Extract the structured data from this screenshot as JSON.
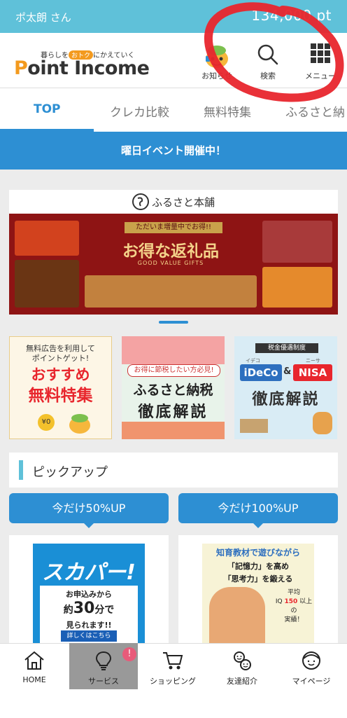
{
  "status": {
    "username": "ポ太朗 さん",
    "points": "134,000 pt"
  },
  "header": {
    "logo_tagline_pre": "暮らしを",
    "logo_tagline_pill": "おトク",
    "logo_tagline_post": "にかえていく",
    "logo_p": "P",
    "logo_rest": "oint Income",
    "news_label": "お知らせ",
    "search_label": "検索",
    "menu_label": "メニュー"
  },
  "tabs": [
    "TOP",
    "クレカ比較",
    "無料特集",
    "ふるさと納"
  ],
  "event_banner": "曜日イベント開催中！",
  "furusato": {
    "brand": "ふるさと本舗",
    "ribbon": "ただいま増量中でお得!!",
    "title": "お得な返礼品",
    "subtitle": "GOOD VALUE GIFTS"
  },
  "banners": {
    "free": {
      "line1": "無料広告を利用して",
      "line2": "ポイントゲット!",
      "line3": "おすすめ",
      "line4": "無料特集",
      "coin": "¥0"
    },
    "tax": {
      "line1": "お得に節税したい方必見!",
      "line2": "ふるさと納税",
      "line3": "徹底解説"
    },
    "ideco": {
      "tag": "税金優遇制度",
      "line1": "iDeCo",
      "amp": "&",
      "line2": "NISA",
      "ruby1": "イデコ",
      "ruby2": "ニーサ",
      "line3": "徹底解説"
    }
  },
  "pickup": {
    "title": "ピックアップ",
    "buttons": [
      "今だけ50%UP",
      "今だけ100%UP"
    ],
    "sky": {
      "logo": "スカパー!",
      "l1": "お申込みから",
      "l2": "約",
      "l3": "30",
      "l4": "分で",
      "l5": "見られます!!",
      "cta": "詳しくはこちら"
    },
    "edu": {
      "l1": "知育教材で遊びながら",
      "l2": "「記憶力」を高め",
      "l3": "「思考力」を鍛える",
      "l4": "平均",
      "l5": "IQ",
      "l6": "150",
      "l7": "以上の",
      "l8": "実績！"
    }
  },
  "bottom_nav": [
    "HOME",
    "サービス",
    "ショッピング",
    "友達紹介",
    "マイページ"
  ],
  "badge": "!",
  "colors": {
    "accent": "#2d8fd3",
    "topbar": "#5fc1d9",
    "logo_orange": "#f39a1e",
    "annotation_red": "#e8262d"
  }
}
